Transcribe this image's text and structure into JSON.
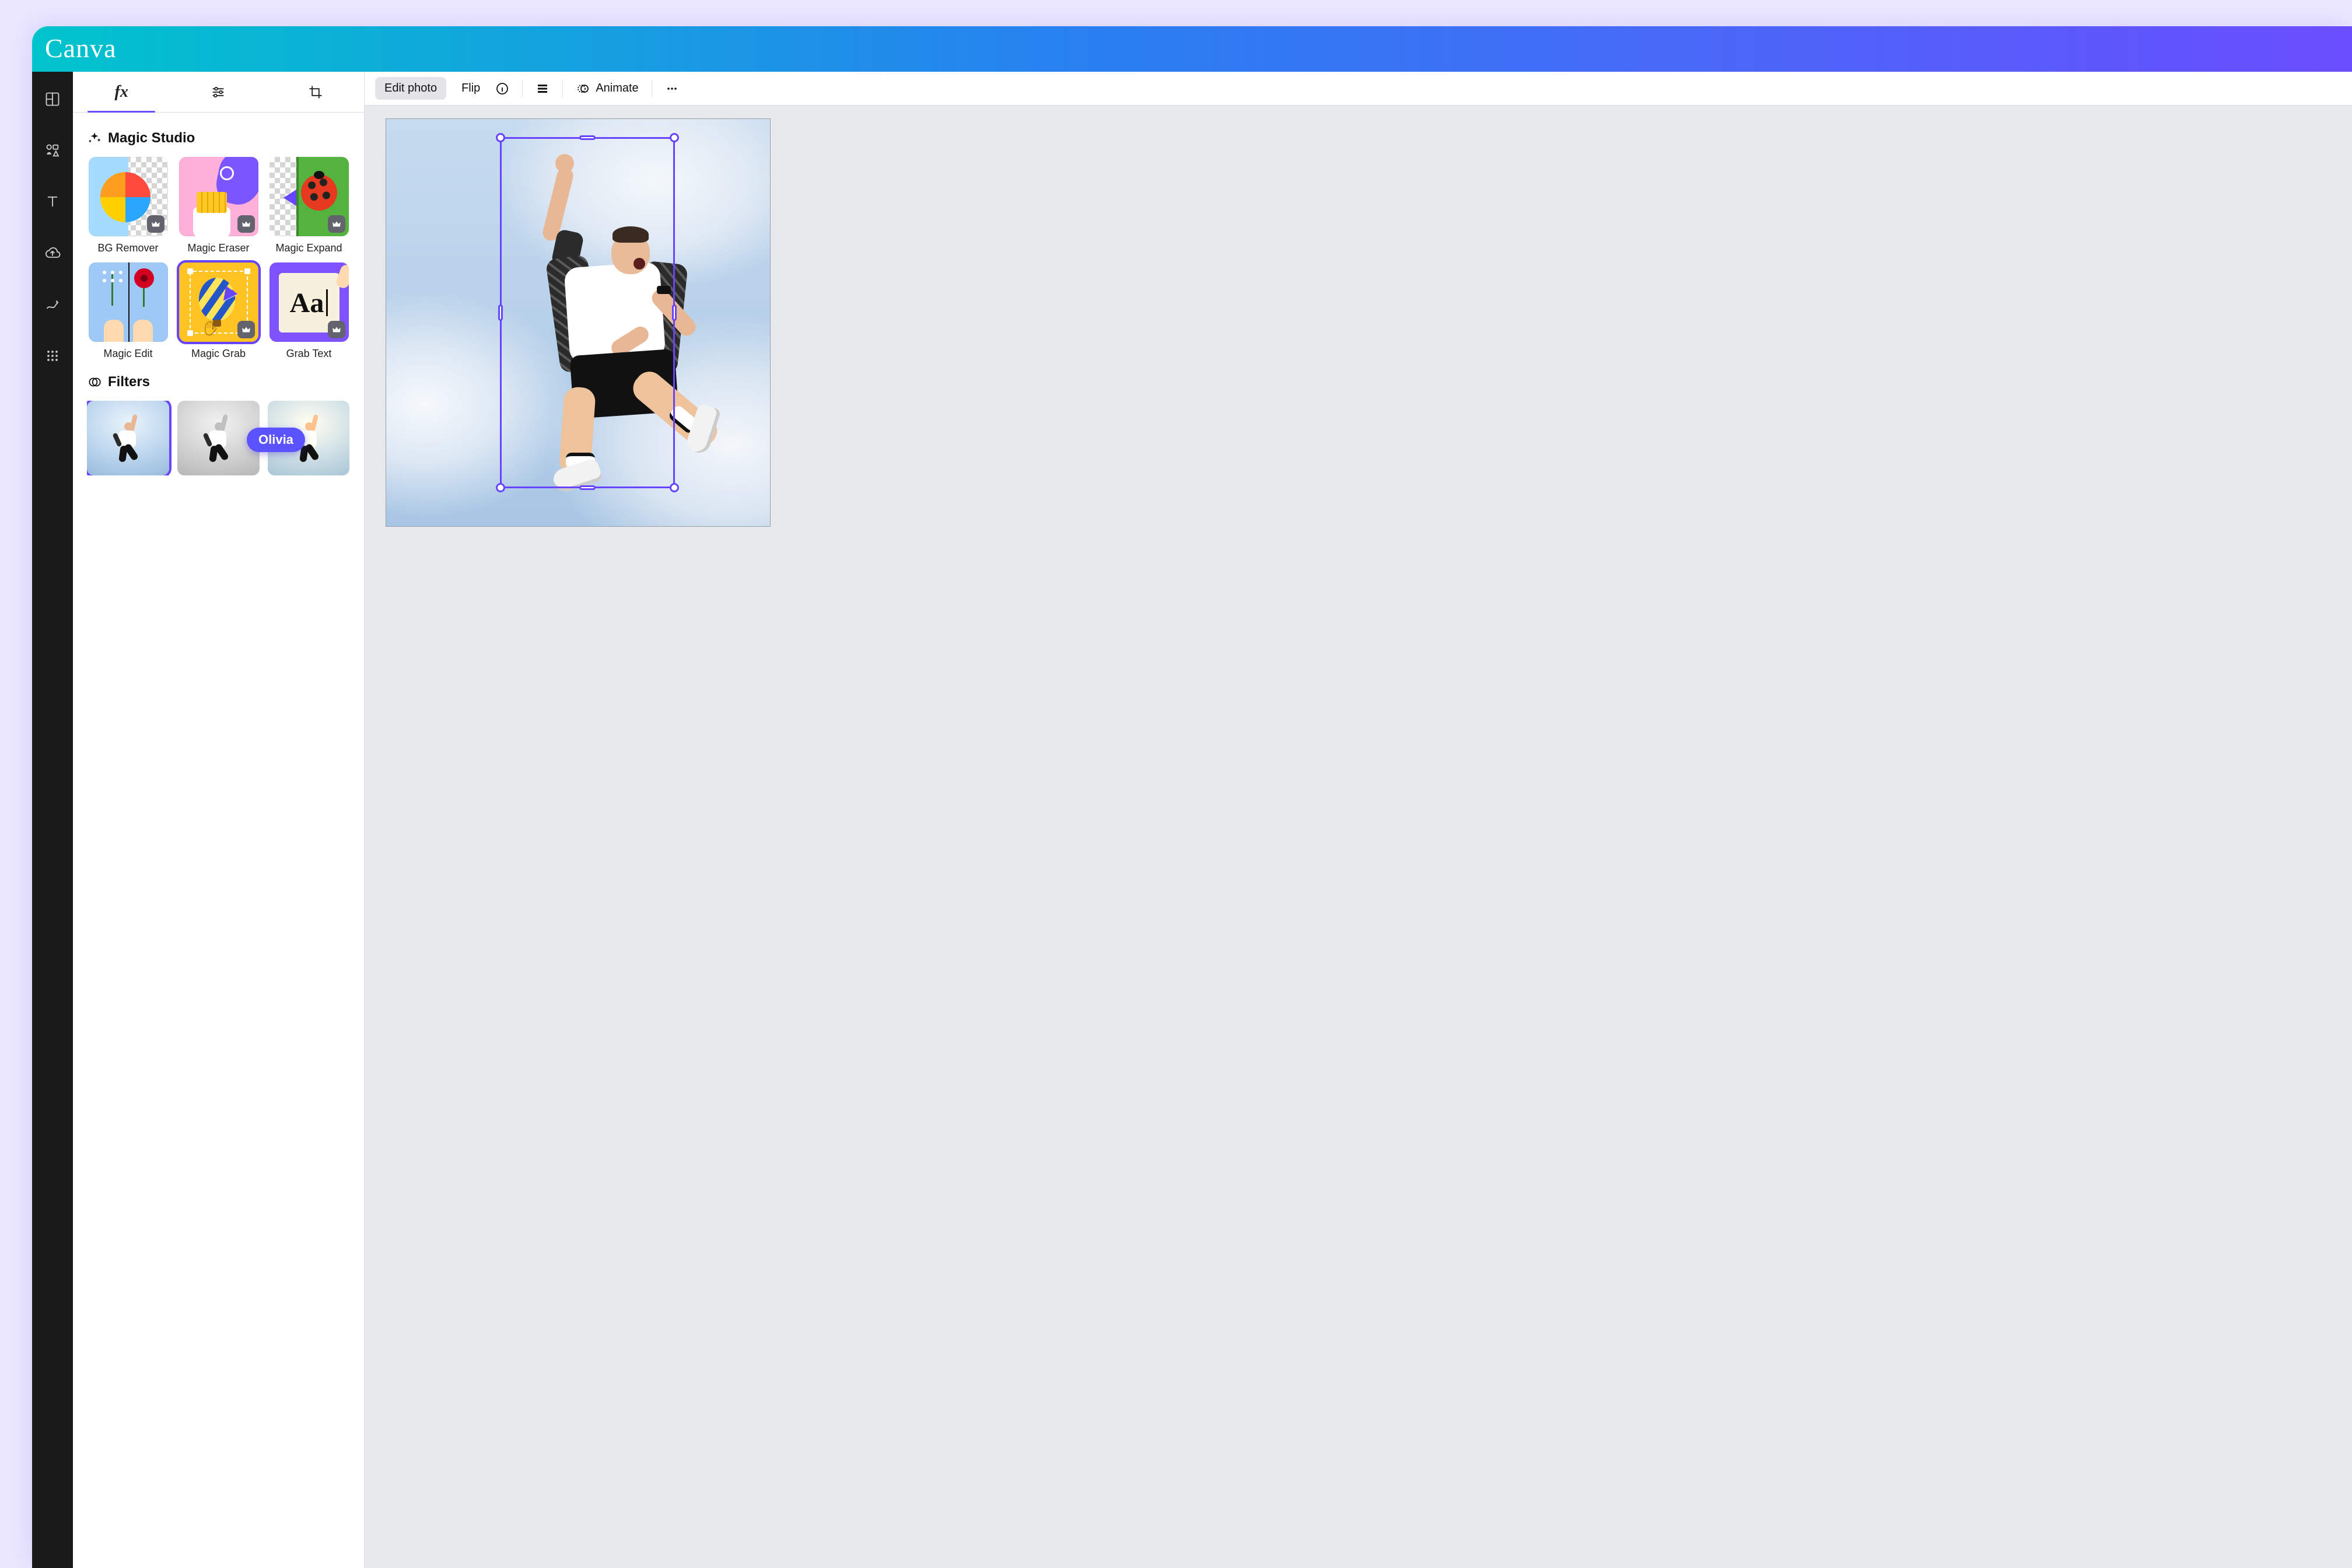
{
  "brand": {
    "name": "Canva"
  },
  "rail": {
    "items": [
      {
        "name": "templates-icon"
      },
      {
        "name": "elements-icon"
      },
      {
        "name": "text-icon"
      },
      {
        "name": "uploads-icon"
      },
      {
        "name": "draw-icon"
      },
      {
        "name": "apps-icon"
      }
    ]
  },
  "panel": {
    "tabs": [
      {
        "name": "effects-tab",
        "kind": "fx",
        "active": true
      },
      {
        "name": "adjust-tab",
        "kind": "adjust",
        "active": false
      },
      {
        "name": "crop-tab",
        "kind": "crop",
        "active": false
      }
    ],
    "sections": {
      "magicStudio": {
        "title": "Magic Studio",
        "tools": [
          {
            "name": "bg-remover",
            "label": "BG Remover",
            "premium": true,
            "selected": false
          },
          {
            "name": "magic-eraser",
            "label": "Magic Eraser",
            "premium": true,
            "selected": false
          },
          {
            "name": "magic-expand",
            "label": "Magic Expand",
            "premium": true,
            "selected": false
          },
          {
            "name": "magic-edit",
            "label": "Magic Edit",
            "premium": false,
            "selected": false
          },
          {
            "name": "magic-grab",
            "label": "Magic Grab",
            "premium": true,
            "selected": true
          },
          {
            "name": "grab-text",
            "label": "Grab Text",
            "premium": true,
            "selected": false
          }
        ]
      },
      "filters": {
        "title": "Filters",
        "items": [
          {
            "name": "filter-original",
            "selected": true,
            "style": "original"
          },
          {
            "name": "filter-greyscale",
            "selected": false,
            "style": "greyscale"
          },
          {
            "name": "filter-warm",
            "selected": false,
            "style": "warm"
          },
          {
            "name": "filter-more",
            "selected": false,
            "style": "original"
          }
        ]
      }
    },
    "collaboratorCursor": {
      "name": "Olivia",
      "color": "#5b53ff"
    }
  },
  "toolbar": {
    "editPhoto": "Edit photo",
    "flip": "Flip",
    "animate": "Animate"
  },
  "canvas": {
    "imageDescription": "Photograph of a man mid-jump against a cloudy blue sky, one fist raised, wearing an open plaid shirt over a white tee and dark shorts.",
    "selection": {
      "active": true
    }
  },
  "colors": {
    "accent": "#6b4eff",
    "selection": "#6745ff",
    "collaborator": "#5b53ff"
  }
}
